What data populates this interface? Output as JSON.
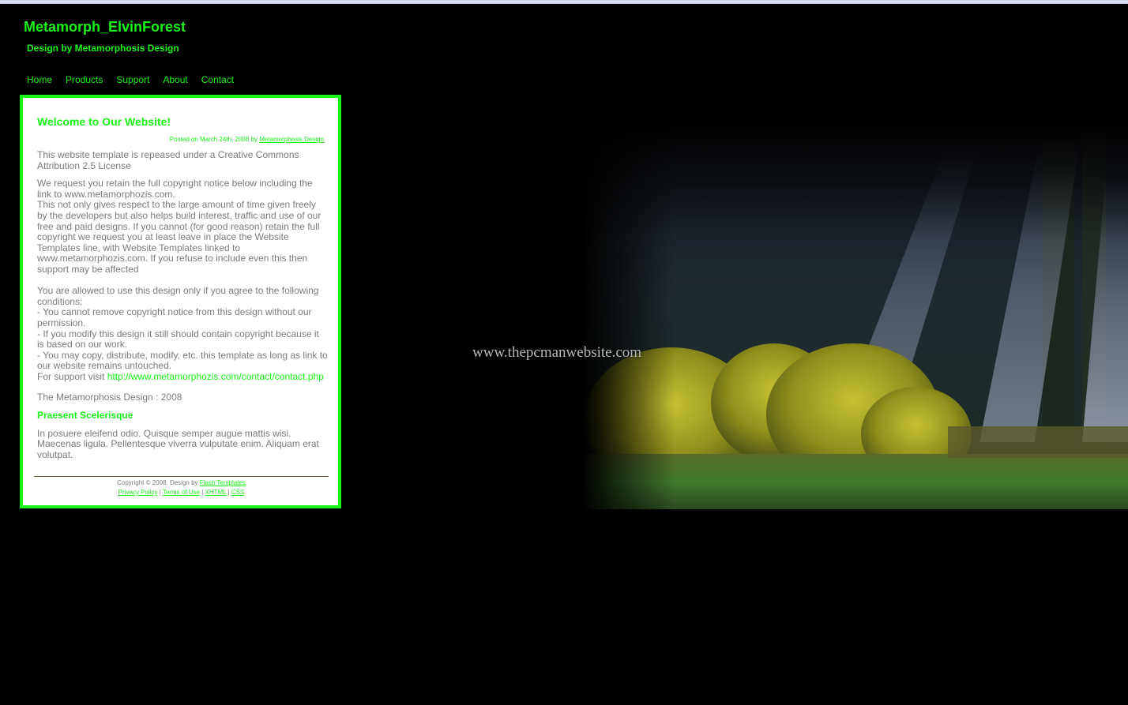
{
  "header": {
    "site_title": "Metamorph_ElvinForest",
    "subtitle": "Design by Metamorphosis Design"
  },
  "nav": {
    "items": [
      {
        "label": "Home"
      },
      {
        "label": "Products"
      },
      {
        "label": "Support"
      },
      {
        "label": "About"
      },
      {
        "label": "Contact"
      }
    ]
  },
  "post": {
    "title": "Welcome to Our Website!",
    "posted_prefix": "Posted on March 24th, 2008 by ",
    "posted_author": "Metamorphosis Design",
    "paragraph1": "This website template is repeased under a Creative Commons Attribution 2.5 License",
    "paragraph2a": "We request you retain the full copyright notice below including the link to www.metamorphozis.com.",
    "paragraph2b": "This not only gives respect to the large amount of time given freely by the developers but also helps build interest, traffic and use of our free and paid designs. If you cannot (for good reason) retain the full copyright we request you at least leave in place the Website Templates line, with Website Templates linked to www.metamorphozis.com. If you refuse to include even this then support may be affected",
    "conditions_intro": "You are allowed to use this design only if you agree to the following conditions:",
    "conditions": [
      "- You cannot remove copyright notice from this design without our permission.",
      "- If you modify this design it still should contain copyright because it is based on our work.",
      "- You may copy, distribute, modify, etc. this template as long as link to our website remains untouched."
    ],
    "support_prefix": "For support visit ",
    "support_link": "http://www.metamorphozis.com/contact/contact.php",
    "signature": "The Metamorphosis Design : 2008",
    "section2_title": "Praesent Scelerisque",
    "section2_text": "In posuere eleifend odio. Quisque semper augue mattis wisi. Maecenas ligula. Pellentesque viverra vulputate enim. Aliquam erat volutpat."
  },
  "footer": {
    "copyright_prefix": "Copyright © 2008. Design by ",
    "copyright_link": "Flash Templates",
    "links": [
      "Privacy Policy",
      "Terms of Use",
      "XHTML",
      "CSS"
    ],
    "separator": " | "
  },
  "hero": {
    "watermark": "www.thepcmanwebsite.com",
    "image_description": "forest-clearing-with-sunbeams"
  },
  "colors": {
    "accent": "#19f419",
    "body_text": "#7b7b7b",
    "background": "#000000",
    "footer_rule": "#6f5a33"
  }
}
